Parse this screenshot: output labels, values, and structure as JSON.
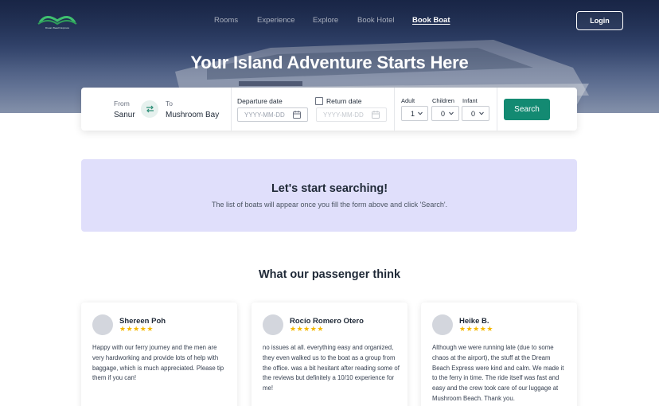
{
  "brand": {
    "logo_text": "Dream Beach Express"
  },
  "nav": {
    "items": [
      {
        "label": "Rooms"
      },
      {
        "label": "Experience"
      },
      {
        "label": "Explore"
      },
      {
        "label": "Book Hotel"
      },
      {
        "label": "Book Boat",
        "active": true
      }
    ],
    "login_label": "Login"
  },
  "hero": {
    "title": "Your Island Adventure Starts Here"
  },
  "search": {
    "from_label": "From",
    "from_value": "Sanur",
    "to_label": "To",
    "to_value": "Mushroom Bay",
    "departure_label": "Departure date",
    "departure_placeholder": "YYYY-MM-DD",
    "return_label": "Return date",
    "return_placeholder": "YYYY-MM-DD",
    "return_checked": false,
    "adult_label": "Adult",
    "adult_value": "1",
    "children_label": "Children",
    "children_value": "0",
    "infant_label": "Infant",
    "infant_value": "0",
    "search_label": "Search"
  },
  "info": {
    "title": "Let's start searching!",
    "text": "The list of boats will appear once you fill the form above and click 'Search'."
  },
  "reviews_section": {
    "title": "What our passenger think"
  },
  "reviews": [
    {
      "name": "Shereen Poh",
      "stars": 5,
      "text": "Happy with our ferry journey and the men are very hardworking and provide lots of help with baggage, which is much appreciated. Please tip them if you can!"
    },
    {
      "name": "Rocío Romero Otero",
      "stars": 5,
      "text": "no issues at all. everything easy and organized, they even walked us to the boat as a group from the office. was a bit hesitant after reading some of the reviews but definitely a 10/10 experience for me!"
    },
    {
      "name": "Heike B.",
      "stars": 5,
      "text": "Although we were running late (due to some chaos at the airport), the stuff at the Dream Beach Express were kind and calm. We made it to the ferry in time. The ride itself was fast and easy and the crew took care of our luggage at Mushroom Beach. Thank you."
    }
  ],
  "colors": {
    "accent": "#138a72",
    "info_bg": "#e0dffb",
    "star": "#f5b800"
  }
}
